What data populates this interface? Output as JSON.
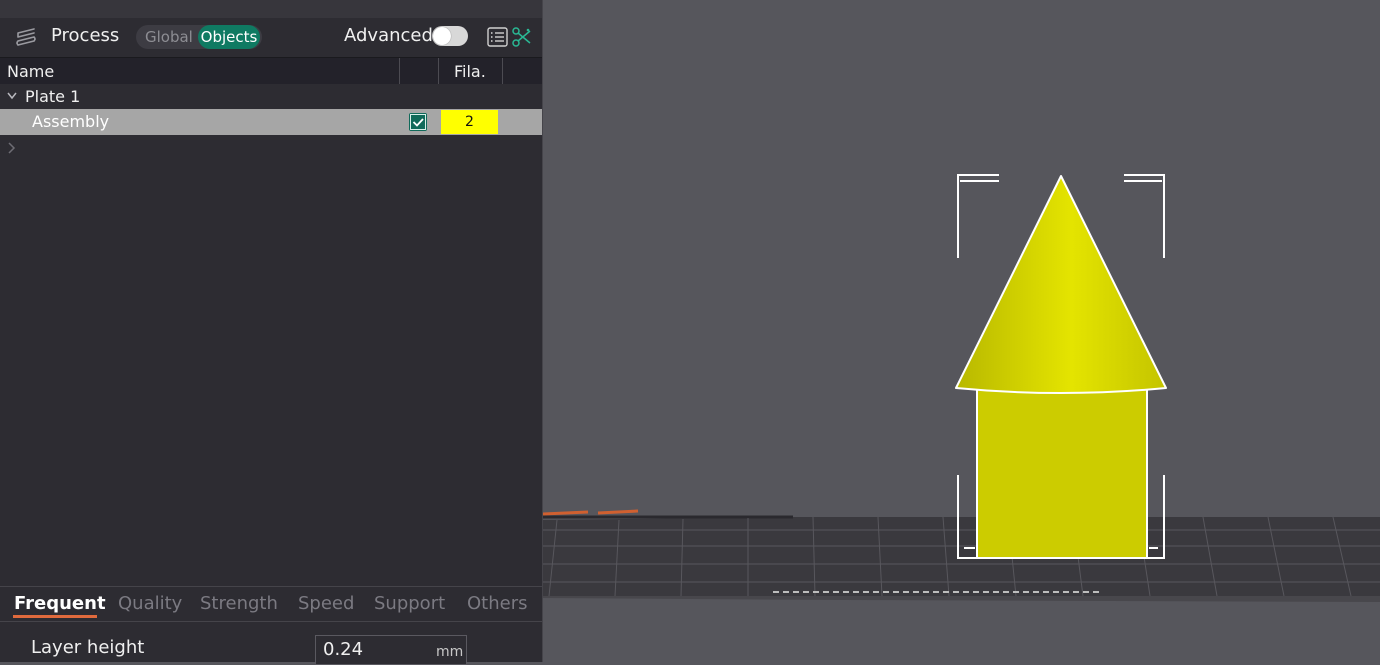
{
  "process_panel": {
    "title": "Process",
    "mode_global": "Global",
    "mode_objects": "Objects",
    "advanced_label": "Advanced",
    "advanced_enabled": false
  },
  "object_table": {
    "headers": {
      "name": "Name",
      "filament": "Fila."
    },
    "plate": {
      "label": "Plate 1",
      "expanded": true
    },
    "items": [
      {
        "name": "Assembly",
        "checked": true,
        "filament": "2",
        "filament_color": "#ffff00",
        "selected": true
      }
    ]
  },
  "settings_tabs": [
    "Frequent",
    "Quality",
    "Strength",
    "Speed",
    "Support",
    "Others"
  ],
  "active_tab": "Frequent",
  "parameters": [
    {
      "label": "Layer height",
      "value": "0.24",
      "unit": "mm"
    }
  ],
  "colors": {
    "accent": "#0f7a62",
    "tab_underline": "#e06a3d",
    "model": "#d4d400",
    "viewport_bg": "#56565c"
  }
}
